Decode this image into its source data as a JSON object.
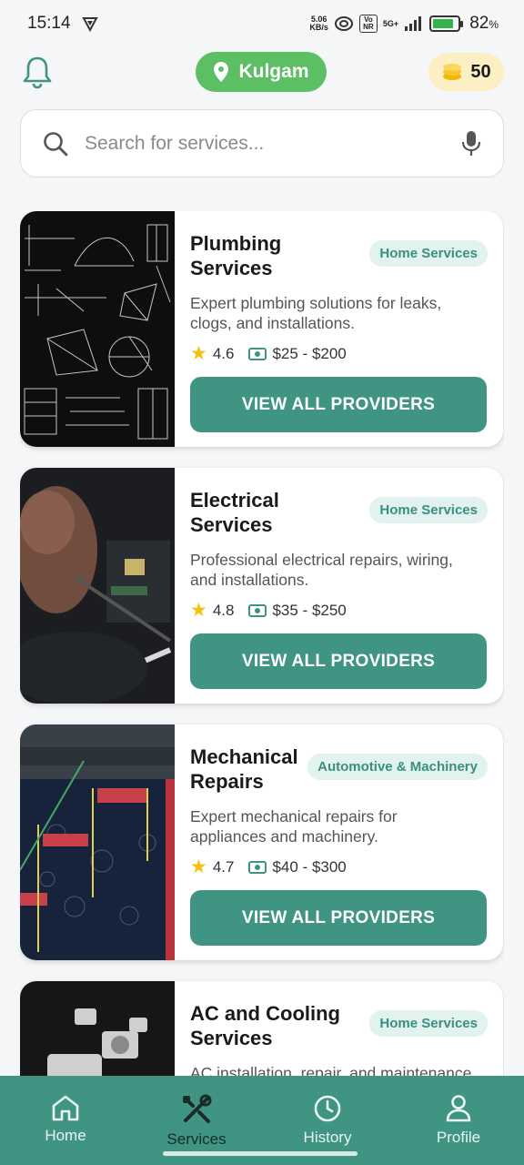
{
  "status_bar": {
    "time": "15:14",
    "speed_value": "5.06",
    "speed_unit": "KB/s",
    "signal_label": "5G+",
    "volte": "Vo NR",
    "battery_percent": "82",
    "battery_suffix": "%"
  },
  "header": {
    "location": "Kulgam",
    "coins": "50"
  },
  "search": {
    "placeholder": "Search for services..."
  },
  "services": [
    {
      "title": "Plumbing Services",
      "category": "Home Services",
      "description": "Expert plumbing solutions for leaks, clogs, and installations.",
      "rating": "4.6",
      "price": "$25 - $200",
      "cta": "VIEW ALL PROVIDERS"
    },
    {
      "title": "Electrical Services",
      "category": "Home Services",
      "description": "Professional electrical repairs, wiring, and installations.",
      "rating": "4.8",
      "price": "$35 - $250",
      "cta": "VIEW ALL PROVIDERS"
    },
    {
      "title": "Mechanical Repairs",
      "category": "Automotive & Machinery",
      "description": "Expert mechanical repairs for appliances and machinery.",
      "rating": "4.7",
      "price": "$40 - $300",
      "cta": "VIEW ALL PROVIDERS"
    },
    {
      "title": "AC and Cooling Services",
      "category": "Home Services",
      "description": "AC installation, repair, and maintenance"
    }
  ],
  "nav": {
    "items": [
      {
        "label": "Home",
        "icon": "home-icon"
      },
      {
        "label": "Services",
        "icon": "tools-icon",
        "active": true
      },
      {
        "label": "History",
        "icon": "clock-icon"
      },
      {
        "label": "Profile",
        "icon": "person-icon"
      }
    ]
  },
  "colors": {
    "primary": "#3f9483",
    "location_pill": "#5dbf64",
    "coin_pill": "#fcefc4",
    "star": "#f4c20d"
  }
}
